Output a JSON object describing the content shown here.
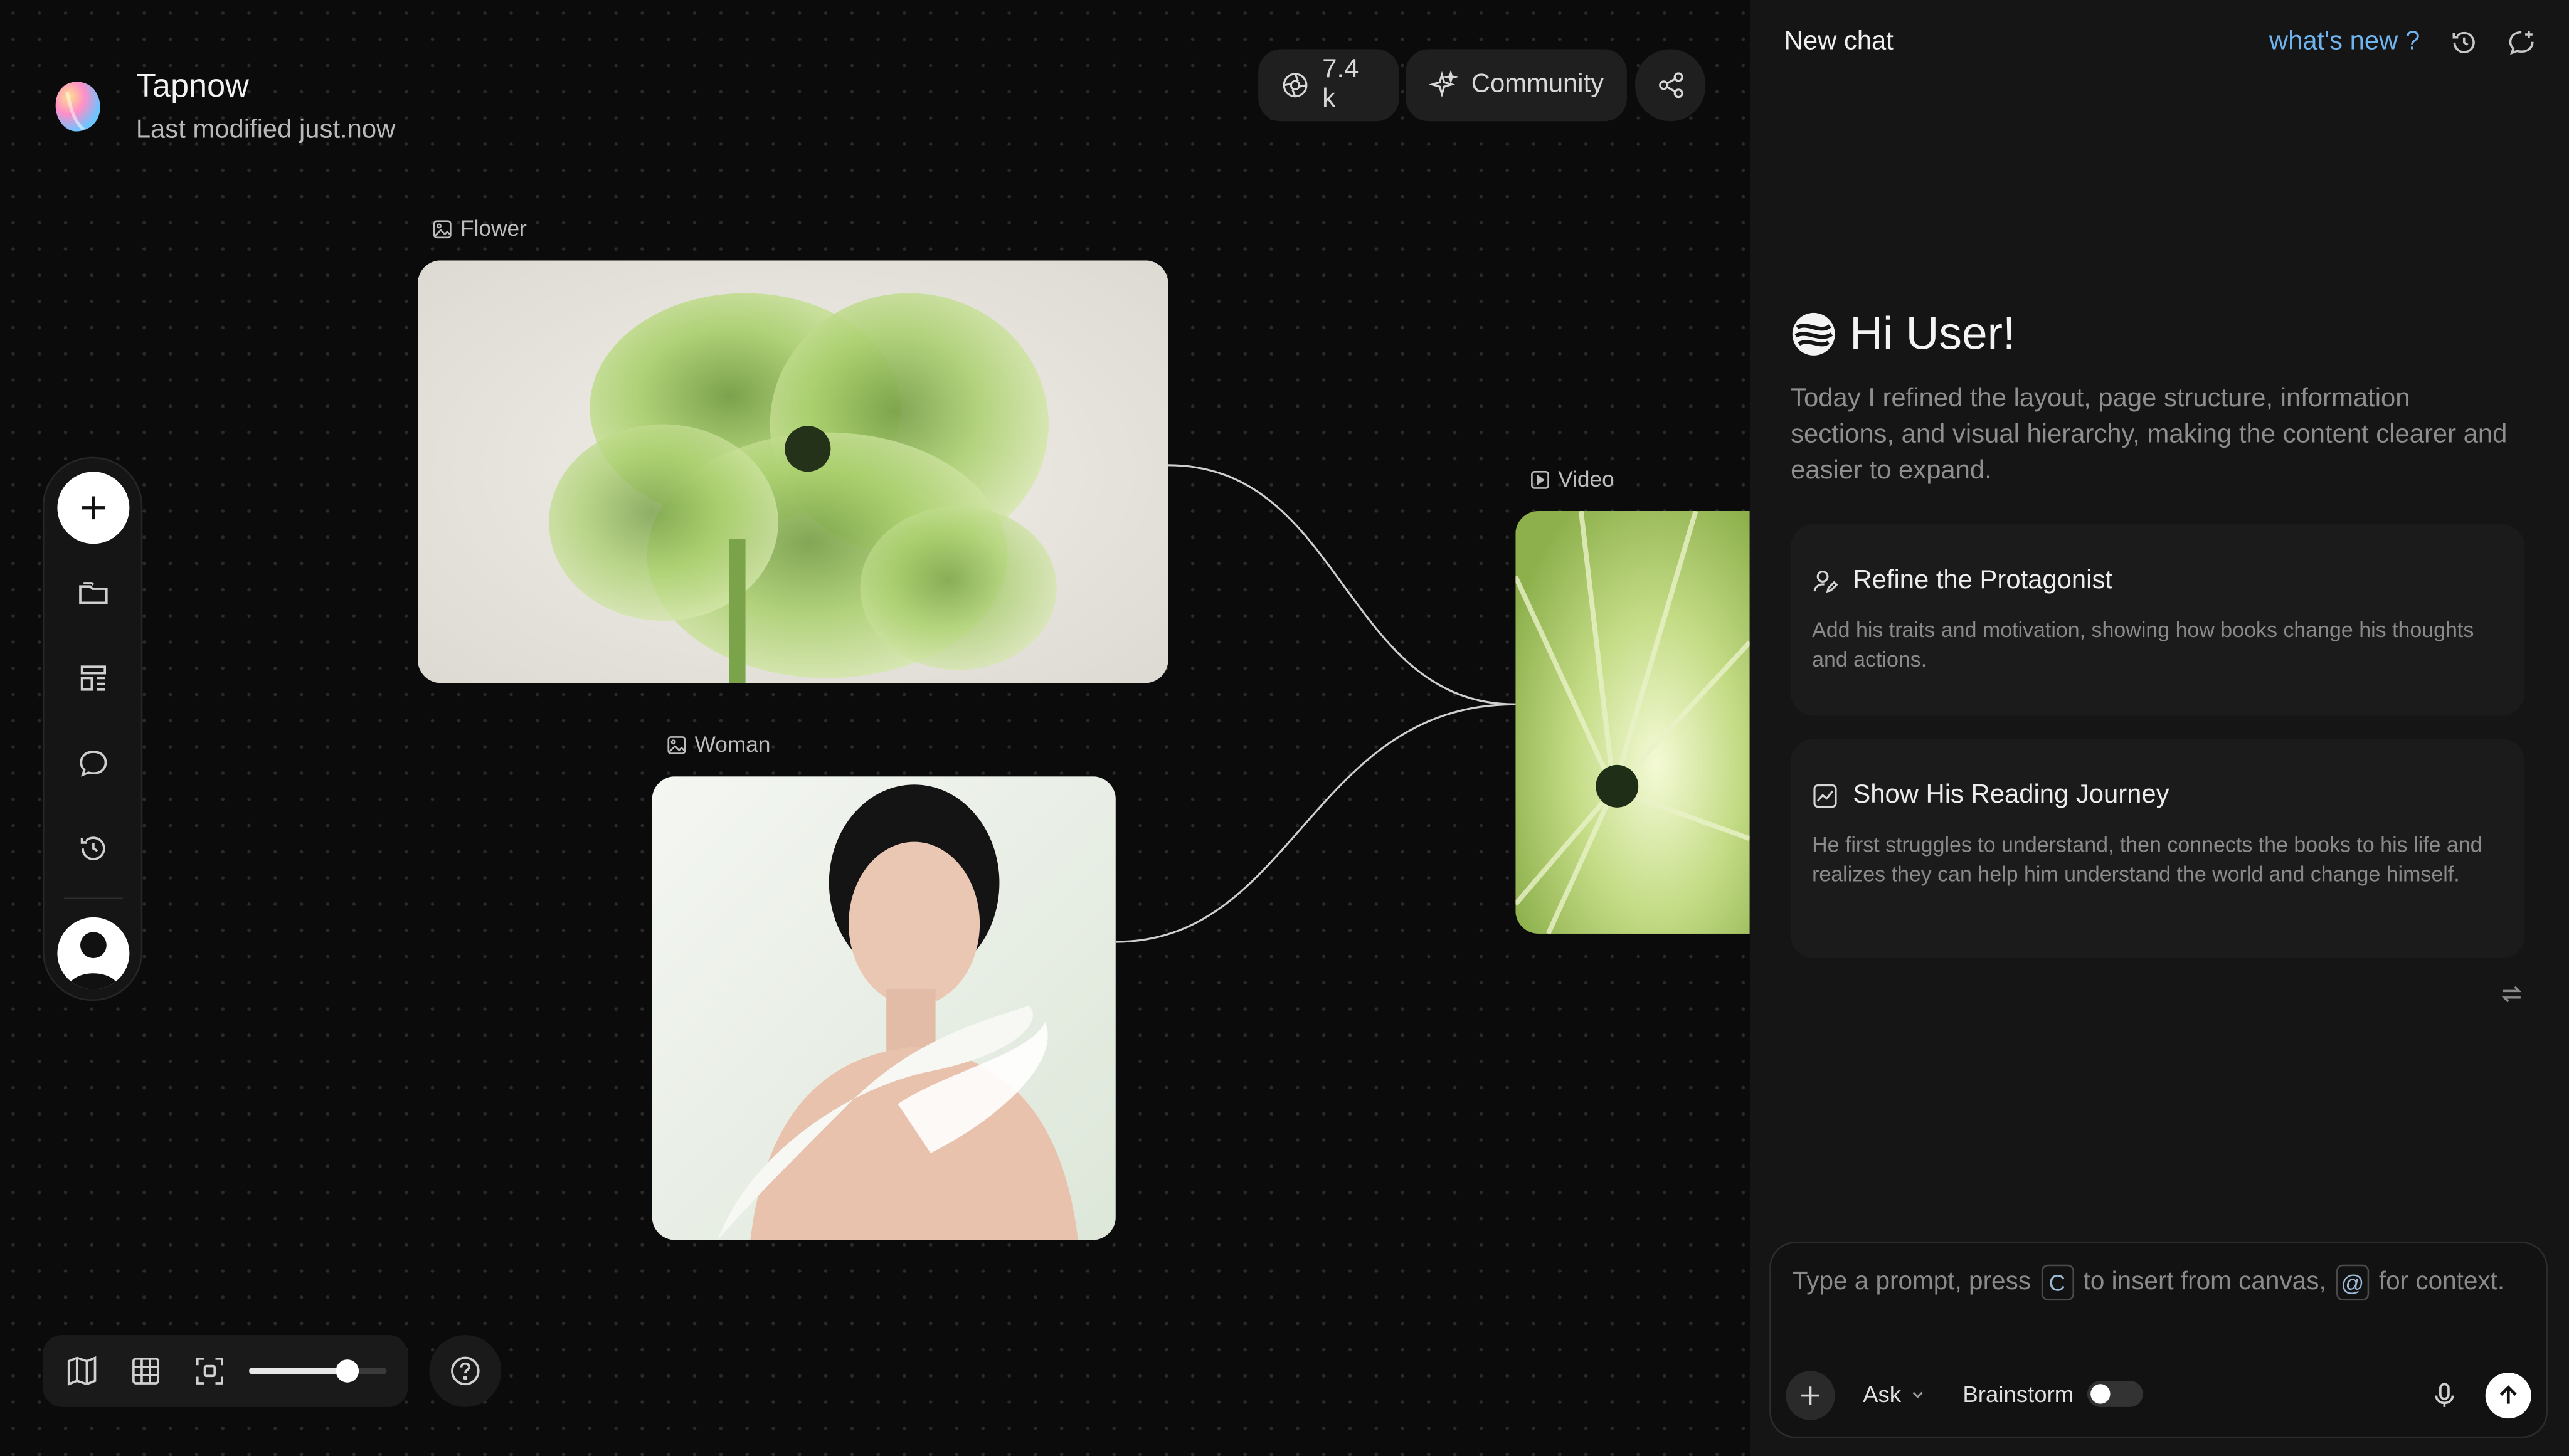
{
  "header": {
    "app_name": "Tapnow",
    "last_modified": "Last modified just.now",
    "stats_count": "7.4 k",
    "community_label": "Community"
  },
  "canvas": {
    "nodes": [
      {
        "label": "Flower",
        "type": "image"
      },
      {
        "label": "Woman",
        "type": "image"
      },
      {
        "label": "Video",
        "type": "video"
      }
    ],
    "zoom_level": 0.72
  },
  "sidebar": {
    "items": [
      "add-icon",
      "folder-icon",
      "layout-icon",
      "chat-icon",
      "history-icon",
      "avatar"
    ]
  },
  "panel": {
    "title": "New chat",
    "whats_new": "what's new ?",
    "greeting": "Hi User!",
    "intro": "Today I refined the layout, page structure, information sections, and visual hierarchy, making the content clearer and easier to expand.",
    "suggestions": [
      {
        "title": "Refine the Protagonist",
        "desc": "Add his traits and motivation, showing how books change his thoughts and actions.",
        "icon": "user-edit-icon"
      },
      {
        "title": "Show His Reading Journey",
        "desc": "He first struggles to understand, then connects the books to his life and realizes they can help him understand the world and change himself.",
        "icon": "chart-icon"
      }
    ]
  },
  "prompt": {
    "part1": "Type a prompt, press",
    "key1": "C",
    "part2": "to insert from canvas,",
    "key2": "@",
    "part3": "for context.",
    "mode": "Ask",
    "brainstorm": "Brainstorm"
  }
}
